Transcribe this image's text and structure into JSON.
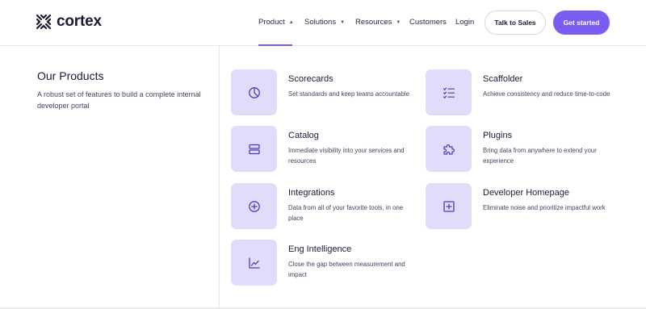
{
  "brand": {
    "name": "cortex",
    "accent": "#7b5cf0"
  },
  "nav": {
    "items": [
      {
        "label": "Product",
        "caret": "▲"
      },
      {
        "label": "Solutions",
        "caret": "▼"
      },
      {
        "label": "Resources",
        "caret": "▼"
      },
      {
        "label": "Customers"
      },
      {
        "label": "Login"
      }
    ],
    "talk_to_sales": "Talk to Sales",
    "get_started": "Get started"
  },
  "intro": {
    "title": "Our Products",
    "description": "A robust set of features to build a complete internal developer portal"
  },
  "products": [
    {
      "title": "Scorecards",
      "description": "Set standards and keep teams accountable",
      "icon": "pie-chart-icon"
    },
    {
      "title": "Scaffolder",
      "description": "Achieve consistency and reduce time-to-code",
      "icon": "checklist-icon"
    },
    {
      "title": "Catalog",
      "description": "Immediate visibility into your services and resources",
      "icon": "catalog-icon"
    },
    {
      "title": "Plugins",
      "description": "Bring data from anywhere to extend your experience",
      "icon": "puzzle-icon"
    },
    {
      "title": "Integrations",
      "description": "Data from all of your favorite tools, in one place",
      "icon": "plus-circle-icon"
    },
    {
      "title": "Developer Homepage",
      "description": "Eliminate noise and prioritize impactful work",
      "icon": "plus-square-icon"
    },
    {
      "title": "Eng Intelligence",
      "description": "Close the gap between measurement and impact",
      "icon": "line-chart-icon"
    }
  ]
}
